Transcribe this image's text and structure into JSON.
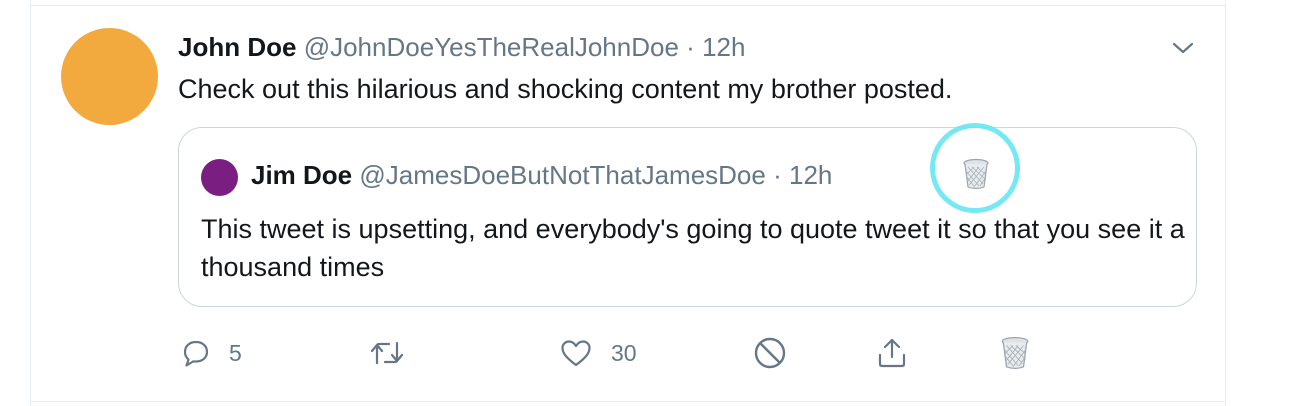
{
  "tweet": {
    "author_name": "John Doe",
    "handle": "@JohnDoeYesTheRealJohnDoe",
    "separator": "·",
    "time": "12h",
    "text": "Check out this hilarious and shocking content my brother posted.",
    "avatar_color": "#f2aa3e",
    "caret_icon": "chevron-down-icon"
  },
  "quoted_tweet": {
    "author_name": "Jim Doe",
    "handle": "@JamesDoeButNotThatJamesDoe",
    "separator": "·",
    "time": "12h",
    "text": "This tweet is upsetting, and everybody's going to quote tweet it so that you see it a thousand times",
    "avatar_color": "#7b1e82",
    "trash_icon": "trash-icon",
    "highlight_color": "#66e7f2"
  },
  "actions": {
    "reply_count": "5",
    "retweet_count": "",
    "like_count": "30",
    "icons": [
      "reply-icon",
      "retweet-icon",
      "like-icon",
      "block-icon",
      "share-icon",
      "trash-icon"
    ]
  },
  "colors": {
    "muted_text": "#657786",
    "border": "#ccd6dd",
    "separator": "#e6ecf0"
  }
}
